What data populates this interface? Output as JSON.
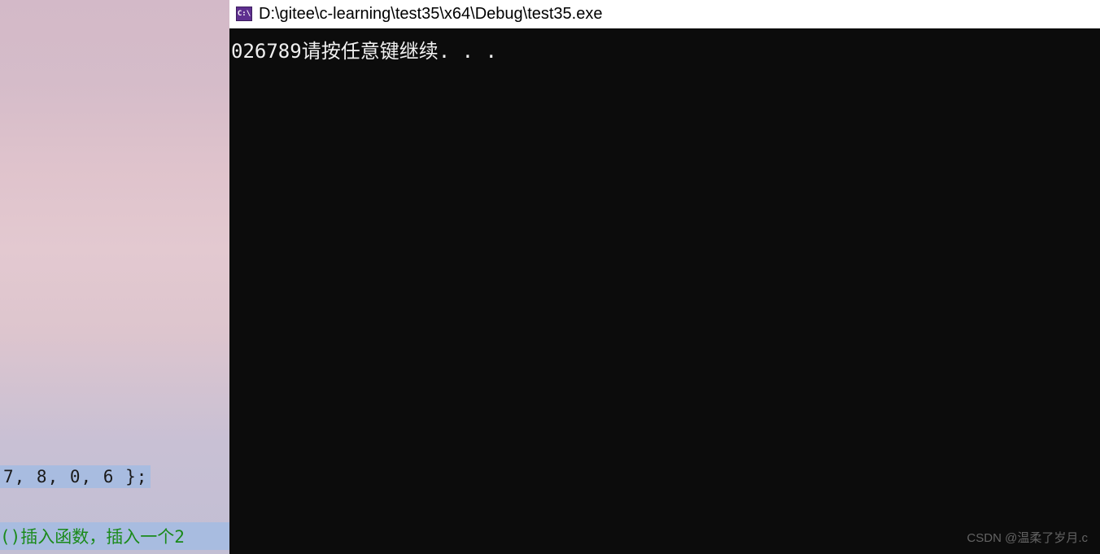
{
  "titlebar": {
    "icon_label": "C:\\",
    "path": "D:\\gitee\\c-learning\\test35\\x64\\Debug\\test35.exe"
  },
  "console": {
    "output": "026789请按任意键继续. . ."
  },
  "background_code": {
    "line1": "7, 8, 0, 6 };",
    "line2": "()插入函数，插入一个2"
  },
  "watermark": {
    "text": "CSDN @温柔了岁月.c"
  }
}
